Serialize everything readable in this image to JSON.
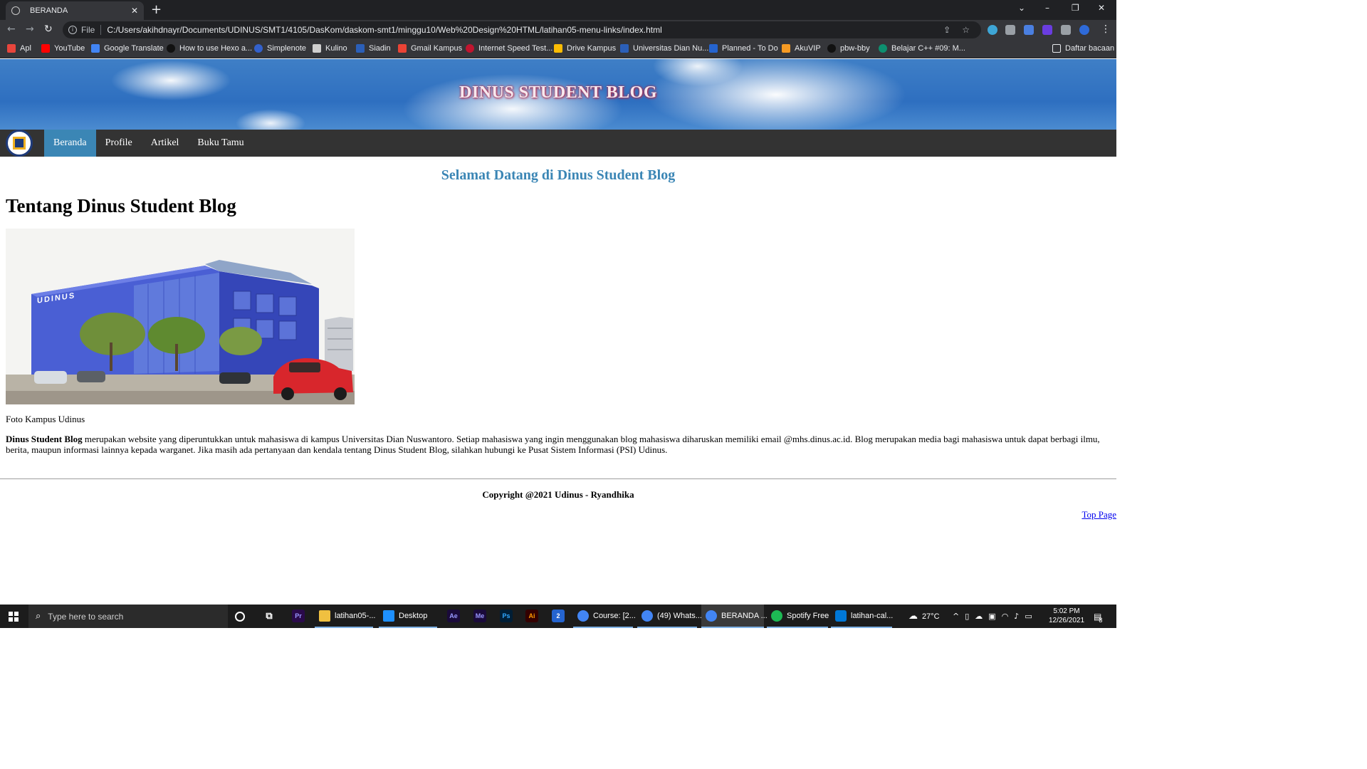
{
  "browser": {
    "tab_title": "BERANDA",
    "scheme_label": "File",
    "url": "C:/Users/akihdnayr/Documents/UDINUS/SMT1/4105/DasKom/daskom-smt1/minggu10/Web%20Design%20HTML/latihan05-menu-links/index.html",
    "bookmarks": [
      {
        "label": "Apl",
        "color": "#e8453c"
      },
      {
        "label": "YouTube",
        "color": "#ff0000"
      },
      {
        "label": "Google Translate",
        "color": "#4285f4"
      },
      {
        "label": "How to use Hexo a...",
        "color": "#111111"
      },
      {
        "label": "Simplenote",
        "color": "#3361cc"
      },
      {
        "label": "Kulino",
        "color": "#ffffff"
      },
      {
        "label": "Siadin",
        "color": "#2b5fb8"
      },
      {
        "label": "Gmail Kampus",
        "color": "#ea4335"
      },
      {
        "label": "Internet Speed Test...",
        "color": "#c0152f"
      },
      {
        "label": "Drive Kampus",
        "color": "#fbbc04"
      },
      {
        "label": "Universitas Dian Nu...",
        "color": "#2b5fb8"
      },
      {
        "label": "Planned - To Do",
        "color": "#2564cf"
      },
      {
        "label": "AkuVIP",
        "color": "#f59a23"
      },
      {
        "label": "pbw-bby",
        "color": "#111111"
      },
      {
        "label": "Belajar C++ #09: M...",
        "color": "#0d8f6f"
      }
    ],
    "reading_list_label": "Daftar bacaan"
  },
  "site": {
    "banner_title": "DINUS STUDENT BLOG",
    "nav": [
      {
        "label": "Beranda",
        "active": true
      },
      {
        "label": "Profile",
        "active": false
      },
      {
        "label": "Artikel",
        "active": false
      },
      {
        "label": "Buku Tamu",
        "active": false
      }
    ],
    "welcome": "Selamat Datang di Dinus Student Blog",
    "heading": "Tentang Dinus Student Blog",
    "photo_sign": "UDINUS",
    "figure_caption": "Foto Kampus Udinus",
    "para_bold": "Dinus Student Blog",
    "para_text": " merupakan website yang diperuntukkan untuk mahasiswa di kampus Universitas Dian Nuswantoro. Setiap mahasiswa yang ingin menggunakan blog mahasiswa diharuskan memiliki email @mhs.dinus.ac.id. Blog merupakan media bagi mahasiswa untuk dapat berbagi ilmu, berita, maupun informasi lainnya kepada warganet. Jika masih ada pertanyaan dan kendala tentang Dinus Student Blog, silahkan hubungi ke Pusat Sistem Informasi (PSI) Udinus.",
    "copyright": "Copyright @2021 Udinus - Ryandhika",
    "top_link": "Top Page",
    "accent_color": "#3b86b5",
    "nav_bg": "#333333"
  },
  "taskbar": {
    "search_placeholder": "Type here to search",
    "pinned_icons": [
      {
        "label": "Pr",
        "bg": "#2a0a4a",
        "fg": "#9999ff"
      },
      {
        "label": "Ae",
        "bg": "#1a0a3a",
        "fg": "#9999ff"
      },
      {
        "label": "Me",
        "bg": "#1a0a3a",
        "fg": "#9999ff"
      },
      {
        "label": "Ps",
        "bg": "#001e36",
        "fg": "#31a8ff"
      },
      {
        "label": "Ai",
        "bg": "#330000",
        "fg": "#ff9a00"
      }
    ],
    "apps": [
      {
        "label": "latihan05-...",
        "color": "#f0c040"
      },
      {
        "label": "Desktop",
        "color": "#1e90ff"
      },
      {
        "label": "Course: [2...",
        "color": "#4285f4"
      },
      {
        "label": "(49) Whats...",
        "color": "#4285f4"
      },
      {
        "label": "BERANDA ...",
        "color": "#4285f4"
      },
      {
        "label": "Spotify Free",
        "color": "#1db954"
      },
      {
        "label": "latihan-cal...",
        "color": "#0078d7"
      }
    ],
    "todo_badge": "2",
    "weather": "27°C",
    "time": "5:02 PM",
    "date": "12/26/2021",
    "notification_count": "8"
  }
}
